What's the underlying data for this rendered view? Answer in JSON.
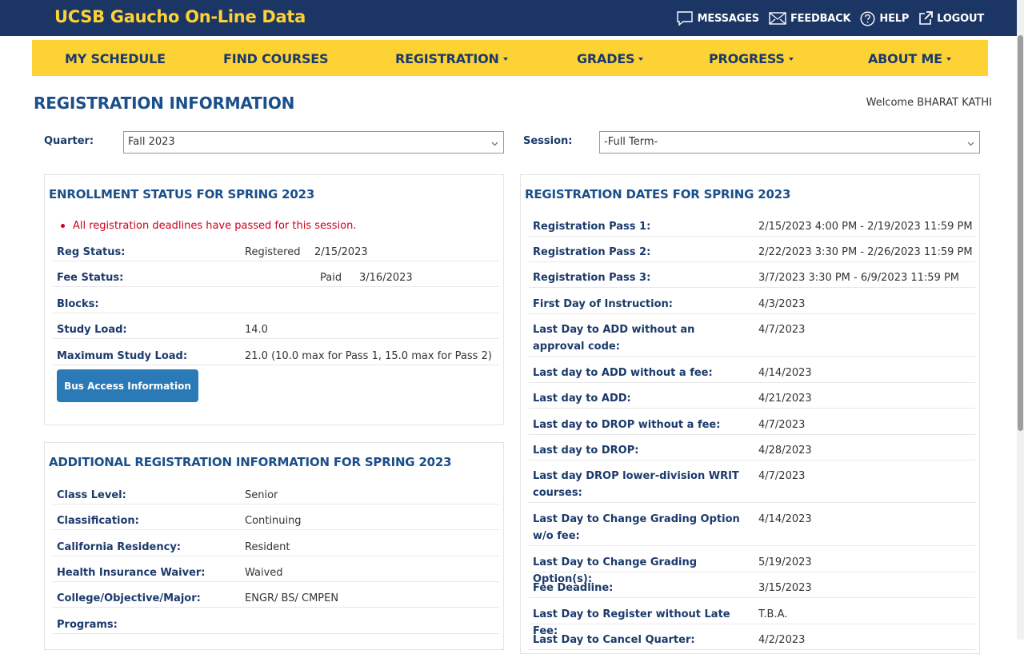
{
  "header": {
    "app_title": "UCSB Gaucho On-Line Data",
    "links": [
      {
        "label": "MESSAGES",
        "icon": "chat-icon"
      },
      {
        "label": "FEEDBACK",
        "icon": "envelope-icon"
      },
      {
        "label": "HELP",
        "icon": "question-circle-icon"
      },
      {
        "label": "LOGOUT",
        "icon": "external-link-icon"
      }
    ]
  },
  "nav": {
    "items": [
      {
        "label": "MY SCHEDULE",
        "dropdown": false
      },
      {
        "label": "FIND COURSES",
        "dropdown": false
      },
      {
        "label": "REGISTRATION",
        "dropdown": true
      },
      {
        "label": "GRADES",
        "dropdown": true
      },
      {
        "label": "PROGRESS",
        "dropdown": true
      },
      {
        "label": "ABOUT ME",
        "dropdown": true
      }
    ]
  },
  "page": {
    "title": "REGISTRATION INFORMATION",
    "welcome": "Welcome BHARAT KATHI"
  },
  "filters": {
    "quarter_label": "Quarter:",
    "quarter_value": "Fall 2023",
    "session_label": "Session:",
    "session_value": "-Full Term-"
  },
  "enrollment": {
    "title": "ENROLLMENT STATUS FOR SPRING 2023",
    "alert": "All registration deadlines have passed for this session.",
    "reg_status_label": "Reg Status:",
    "reg_status_value": "Registered",
    "reg_status_date": "2/15/2023",
    "fee_status_label": "Fee Status:",
    "fee_status_value": "Paid",
    "fee_status_date": "3/16/2023",
    "blocks_label": "Blocks:",
    "study_load_label": "Study Load:",
    "study_load_value": "14.0",
    "max_load_label": "Maximum Study Load:",
    "max_load_value": "21.0 (10.0 max for Pass 1, 15.0 max for Pass 2)",
    "bus_button": "Bus Access Information"
  },
  "additional": {
    "title": "ADDITIONAL REGISTRATION INFORMATION FOR SPRING 2023",
    "rows": [
      {
        "label": "Class Level:",
        "value": "Senior"
      },
      {
        "label": "Classification:",
        "value": "Continuing"
      },
      {
        "label": "California Residency:",
        "value": "Resident"
      },
      {
        "label": "Health Insurance Waiver:",
        "value": "Waived"
      },
      {
        "label": "College/Objective/Major:",
        "value": "ENGR/ BS/ CMPEN"
      },
      {
        "label": "Programs:",
        "value": ""
      }
    ]
  },
  "dates": {
    "title": "REGISTRATION DATES FOR SPRING 2023",
    "rows": [
      {
        "label": "Registration Pass 1:",
        "value": "2/15/2023 4:00 PM - 2/19/2023 11:59 PM"
      },
      {
        "label": "Registration Pass 2:",
        "value": "2/22/2023 3:30 PM - 2/26/2023 11:59 PM"
      },
      {
        "label": "Registration Pass 3:",
        "value": "3/7/2023 3:30 PM - 6/9/2023 11:59 PM"
      },
      {
        "label": "First Day of Instruction:",
        "value": "4/3/2023"
      },
      {
        "label": "Last Day to ADD without an approval code:",
        "value": "4/7/2023"
      },
      {
        "label": "Last day to ADD without a fee:",
        "value": "4/14/2023"
      },
      {
        "label": "Last day to ADD:",
        "value": "4/21/2023"
      },
      {
        "label": "Last day to DROP without a fee:",
        "value": "4/7/2023"
      },
      {
        "label": "Last day to DROP:",
        "value": "4/28/2023"
      },
      {
        "label": "Last day DROP lower-division WRIT courses:",
        "value": "4/7/2023"
      },
      {
        "label": "Last Day to Change Grading Option w/o fee:",
        "value": "4/14/2023"
      },
      {
        "label": "Last Day to Change Grading Option(s):",
        "value": "5/19/2023"
      },
      {
        "label": "Fee Deadline:",
        "value": "3/15/2023"
      },
      {
        "label": "Last Day to Register without Late Fee:",
        "value": "T.B.A."
      },
      {
        "label": "Last Day to Cancel Quarter:",
        "value": "4/2/2023"
      }
    ]
  }
}
